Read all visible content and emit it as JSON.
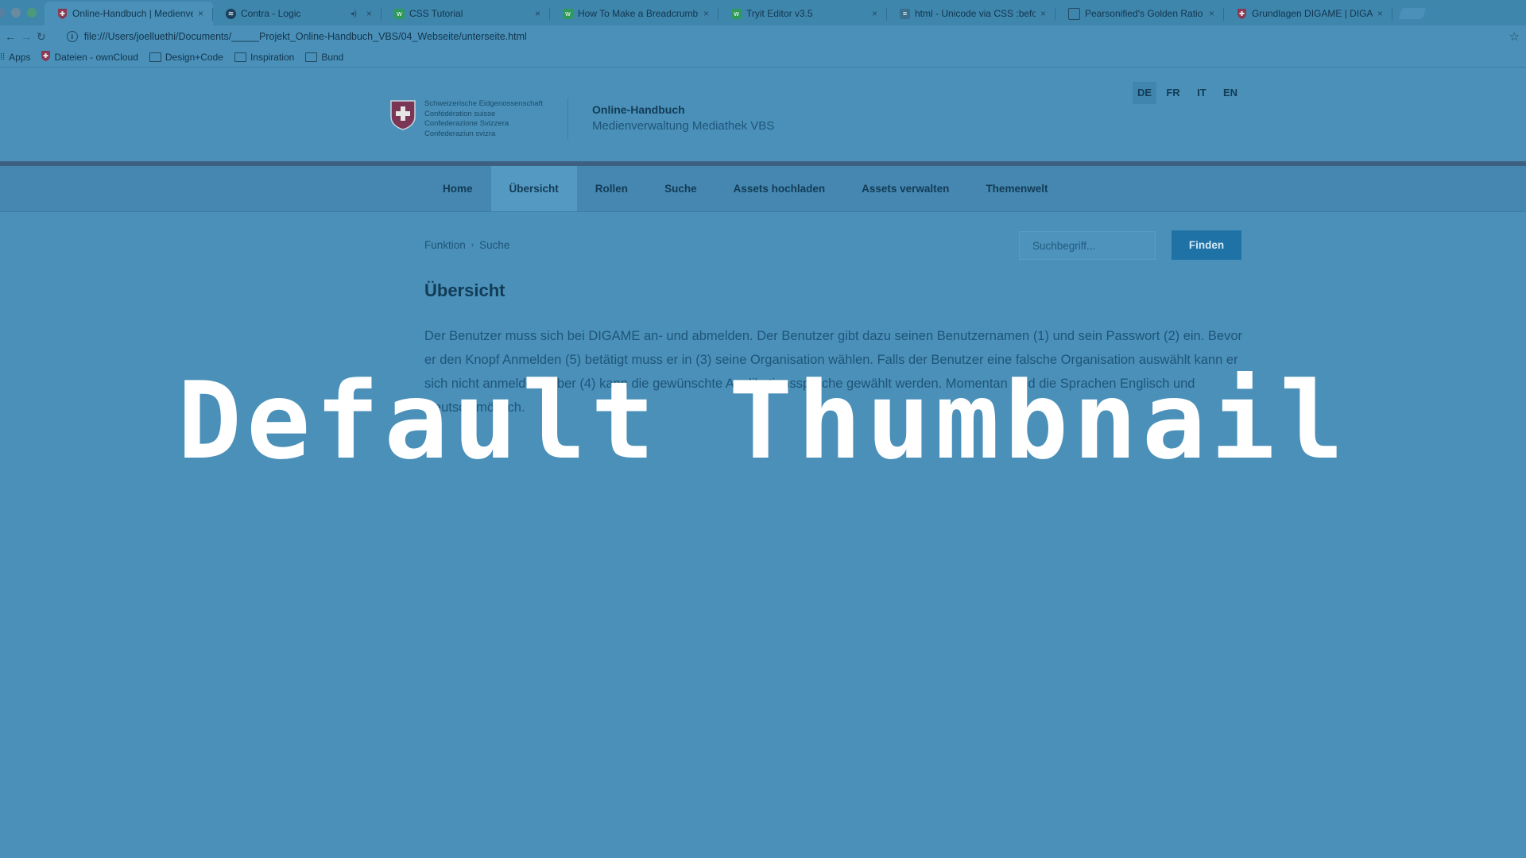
{
  "browser": {
    "tabs": [
      {
        "label": "Online-Handbuch | Medienver",
        "icon": "swiss-shield-icon",
        "active": true
      },
      {
        "label": "Contra - Logic",
        "icon": "spotify-icon",
        "sound": true
      },
      {
        "label": "CSS Tutorial",
        "icon": "w3schools-icon"
      },
      {
        "label": "How To Make a Breadcrumb N",
        "icon": "w3schools-icon"
      },
      {
        "label": "Tryit Editor v3.5",
        "icon": "w3schools-icon"
      },
      {
        "label": "html - Unicode via CSS :befor",
        "icon": "stackoverflow-icon"
      },
      {
        "label": "Pearsonified's Golden Ratio Ty",
        "icon": "document-icon"
      },
      {
        "label": "Grundlagen DIGAME | DIGAME",
        "icon": "swiss-shield-icon"
      }
    ],
    "address": "file:///Users/joelluethi/Documents/_____Projekt_Online-Handbuch_VBS/04_Webseite/unterseite.html",
    "bookmarks": [
      {
        "label": "Apps",
        "icon": "apps-grid-icon"
      },
      {
        "label": "Dateien - ownCloud",
        "icon": "swiss-shield-icon"
      },
      {
        "label": "Design+Code",
        "icon": "folder-icon"
      },
      {
        "label": "Inspiration",
        "icon": "folder-icon"
      },
      {
        "label": "Bund",
        "icon": "folder-icon"
      }
    ]
  },
  "header": {
    "confederation_lines": [
      "Schweizerische Eidgenossenschaft",
      "Confédération suisse",
      "Confederazione Svizzera",
      "Confederaziun svizra"
    ],
    "site_title": "Online-Handbuch",
    "site_subtitle": "Medienverwaltung Mediathek VBS",
    "languages": [
      "DE",
      "FR",
      "IT",
      "EN"
    ],
    "active_language": "DE"
  },
  "nav": {
    "items": [
      "Home",
      "Übersicht",
      "Rollen",
      "Suche",
      "Assets hochladen",
      "Assets verwalten",
      "Themenwelt"
    ],
    "active": "Übersicht"
  },
  "breadcrumb": [
    "Funktion",
    "Suche"
  ],
  "search": {
    "placeholder": "Suchbegriff...",
    "button": "Finden"
  },
  "content": {
    "title": "Übersicht",
    "paragraph": "Der Benutzer muss sich bei DIGAME an- und abmelden. Der Benutzer gibt dazu seinen Benutzernamen (1) und sein Passwort (2) ein. Bevor er den Knopf Anmelden (5) betätigt muss er in (3) seine Organisation wählen. Falls der Benutzer eine falsche Organisation auswählt kann er sich nicht anmelden. Über (4) kann die gewünschte Applikationssprache gewählt werden. Momentan sind die Sprachen Englisch und Deutsch möglich."
  },
  "overlay": {
    "text": "Default Thumbnail"
  },
  "colors": {
    "tint": "#4a90b8",
    "button": "#1e72a6",
    "accent_bar": "#3d5f80"
  }
}
